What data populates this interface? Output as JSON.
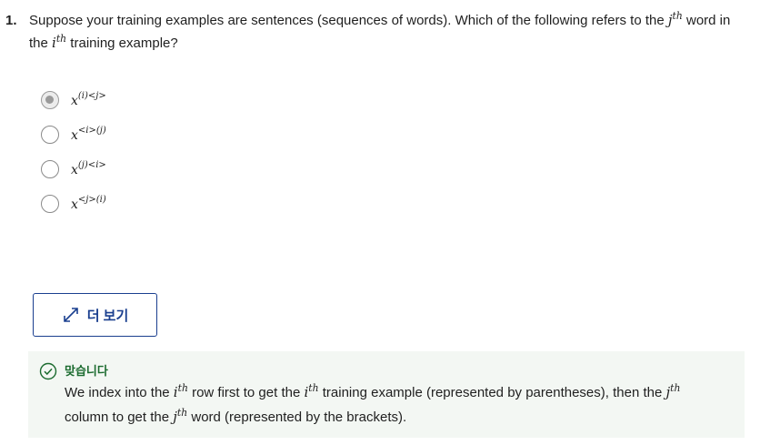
{
  "question": {
    "number": "1.",
    "text_part1": "Suppose your training examples are sentences (sequences of words). Which of the following refers to the ",
    "var_j": "j",
    "sup_th": "th",
    "text_part2": " word in the ",
    "var_i": "i",
    "text_part3": " training example?"
  },
  "options": [
    {
      "base": "x",
      "sup": "(i)<j>",
      "selected": true
    },
    {
      "base": "x",
      "sup": "<i>(j)",
      "selected": false
    },
    {
      "base": "x",
      "sup": "(j)<i>",
      "selected": false
    },
    {
      "base": "x",
      "sup": "<j>(i)",
      "selected": false
    }
  ],
  "more_button": {
    "label": "더 보기",
    "icon": "expand-arrows-icon"
  },
  "feedback": {
    "status": "맞습니다",
    "icon": "check-circle-icon",
    "text_part1": "We index into the ",
    "var_i": "i",
    "sup_th": "th",
    "text_part2": " row first to get the ",
    "text_part3": " training example (represented by parentheses), then the ",
    "var_j": "j",
    "text_part4": " column to get the ",
    "text_part5": " word (represented by the brackets)."
  },
  "colors": {
    "accent": "#1a3f8f",
    "success": "#1b6b2f",
    "feedback_bg": "#f3f7f3"
  }
}
